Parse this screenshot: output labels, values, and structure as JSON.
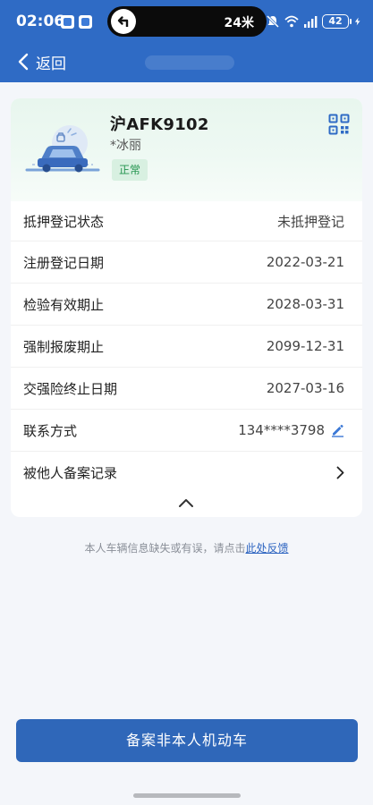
{
  "status_bar": {
    "time": "02:06",
    "nav_distance": "24米",
    "battery": "42",
    "icons": [
      "mute-icon",
      "wifi-icon",
      "cell-signal-icon",
      "battery-icon"
    ]
  },
  "nav": {
    "back_label": "返回"
  },
  "vehicle": {
    "plate": "沪AFK9102",
    "owner": "*冰丽",
    "status": "正常",
    "status_color": "#23944e",
    "qr_icon": "qr-code-icon"
  },
  "info_rows": [
    {
      "label": "抵押登记状态",
      "value": "未抵押登记"
    },
    {
      "label": "注册登记日期",
      "value": "2022-03-21"
    },
    {
      "label": "检验有效期止",
      "value": "2028-03-31"
    },
    {
      "label": "强制报废期止",
      "value": "2099-12-31"
    },
    {
      "label": "交强险终止日期",
      "value": "2027-03-16"
    },
    {
      "label": "联系方式",
      "value": "134****3798"
    },
    {
      "label": "被他人备案记录",
      "value": ""
    }
  ],
  "feedback": {
    "text": "本人车辆信息缺失或有误，请点击",
    "link": "此处反馈"
  },
  "primary_button": {
    "label": "备案非本人机动车"
  },
  "colors": {
    "header": "#2f6bc5",
    "button": "#2f67b9",
    "link": "#2b63c0"
  }
}
